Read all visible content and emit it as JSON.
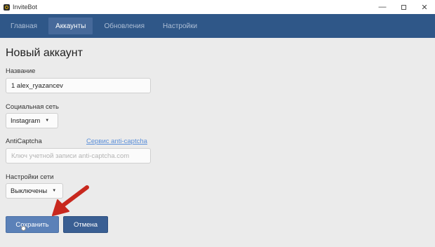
{
  "window": {
    "title": "InviteBot",
    "minimize_glyph": "—",
    "close_glyph": "✕"
  },
  "nav": {
    "tabs": [
      {
        "label": "Главная",
        "active": false
      },
      {
        "label": "Аккаунты",
        "active": true
      },
      {
        "label": "Обновления",
        "active": false
      },
      {
        "label": "Настройки",
        "active": false
      }
    ]
  },
  "form": {
    "title": "Новый аккаунт",
    "name": {
      "label": "Название",
      "value": "1 alex_ryazancev"
    },
    "network": {
      "label": "Социальная сеть",
      "value": "Instagram"
    },
    "anticaptcha": {
      "label": "AntiCaptcha",
      "link": "Сервис anti-captcha",
      "placeholder": "Ключ учетной записи anti-captcha.com"
    },
    "proxy": {
      "label": "Настройки сети",
      "value": "Выключены"
    },
    "save_label": "Сохранить",
    "cancel_label": "Отмена"
  },
  "colors": {
    "navbar": "#2f5788",
    "active_tab": "#46699a",
    "button": "#3a5f93",
    "link": "#5b8fd9",
    "annotation_arrow": "#c8281e"
  },
  "icons": {
    "caret": "▼",
    "annotation": "red-arrow-icon"
  }
}
